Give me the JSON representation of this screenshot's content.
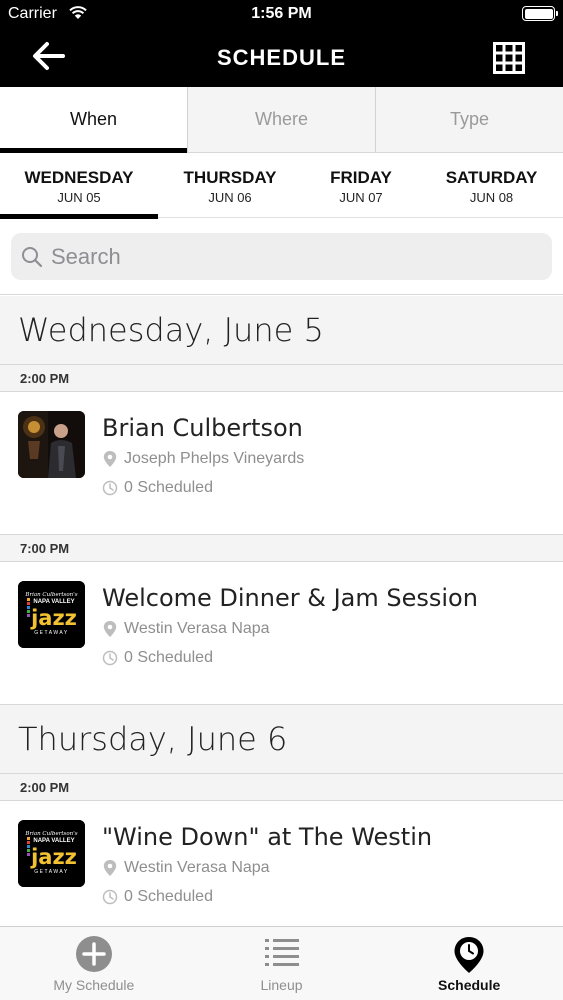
{
  "status_bar": {
    "carrier": "Carrier",
    "time": "1:56 PM"
  },
  "header": {
    "title": "SCHEDULE"
  },
  "filter_tabs": [
    {
      "label": "When",
      "active": true
    },
    {
      "label": "Where",
      "active": false
    },
    {
      "label": "Type",
      "active": false
    }
  ],
  "days": [
    {
      "name": "WEDNESDAY",
      "date": "JUN 05",
      "active": true
    },
    {
      "name": "THURSDAY",
      "date": "JUN 06",
      "active": false
    },
    {
      "name": "FRIDAY",
      "date": "JUN 07",
      "active": false
    },
    {
      "name": "SATURDAY",
      "date": "JUN 08",
      "active": false
    }
  ],
  "search": {
    "placeholder": "Search"
  },
  "sections": [
    {
      "day_title": "Wednesday, June 5",
      "slots": [
        {
          "time": "2:00 PM",
          "event": {
            "title": "Brian Culbertson",
            "location": "Joseph Phelps Vineyards",
            "scheduled": "0 Scheduled",
            "thumb": "artist-photo"
          }
        },
        {
          "time": "7:00 PM",
          "event": {
            "title": "Welcome Dinner & Jam Session",
            "location": "Westin Verasa Napa",
            "scheduled": "0 Scheduled",
            "thumb": "jazz-getaway-logo"
          }
        }
      ]
    },
    {
      "day_title": "Thursday, June 6",
      "slots": [
        {
          "time": "2:00 PM",
          "event": {
            "title": "\"Wine Down\" at The Westin",
            "location": "Westin Verasa Napa",
            "scheduled": "0 Scheduled",
            "thumb": "jazz-getaway-logo"
          }
        }
      ]
    }
  ],
  "logo_text": {
    "line1": "Brian Culbertson's",
    "line2": "NAPA VALLEY",
    "line3": "jazz",
    "line4": "GETAWAY"
  },
  "tab_bar": [
    {
      "label": "My Schedule",
      "icon": "plus-circle-icon",
      "active": false
    },
    {
      "label": "Lineup",
      "icon": "list-icon",
      "active": false
    },
    {
      "label": "Schedule",
      "icon": "clock-pin-icon",
      "active": true
    }
  ]
}
